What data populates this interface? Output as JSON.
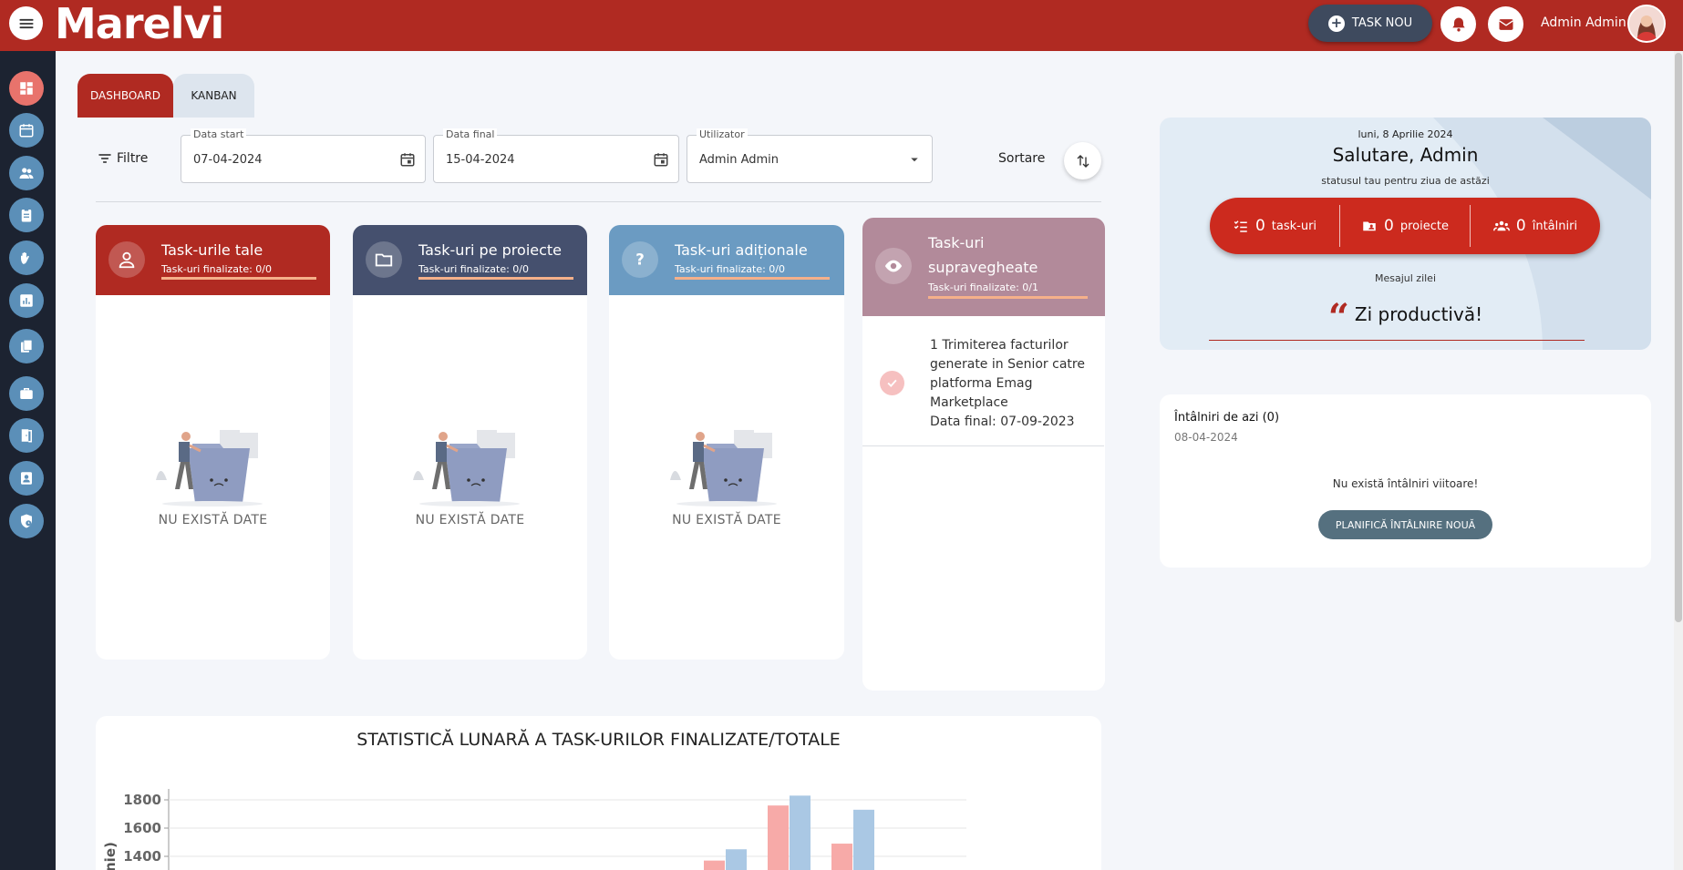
{
  "app": {
    "logo": "Marelvi",
    "new_task_label": "TASK NOU",
    "user_name": "Admin Admin"
  },
  "sidebar": {
    "items": [
      {
        "icon": "dashboard-icon"
      },
      {
        "icon": "calendar-icon"
      },
      {
        "icon": "users-icon"
      },
      {
        "icon": "clipboard-icon"
      },
      {
        "icon": "hand-icon"
      },
      {
        "icon": "bar-chart-icon"
      },
      {
        "icon": "documents-icon"
      },
      {
        "icon": "briefcase-icon"
      },
      {
        "icon": "door-icon"
      },
      {
        "icon": "contact-card-icon"
      },
      {
        "icon": "shield-clock-icon"
      }
    ]
  },
  "tabs": [
    {
      "label": "DASHBOARD",
      "active": true
    },
    {
      "label": "KANBAN",
      "active": false
    }
  ],
  "filters": {
    "label": "Filtre",
    "date_start_label": "Data start",
    "date_start_value": "07-04-2024",
    "date_end_label": "Data final",
    "date_end_value": "15-04-2024",
    "user_label": "Utilizator",
    "user_value": "Admin Admin",
    "sort_label": "Sortare"
  },
  "columns": [
    {
      "title": "Task-urile tale",
      "subtitle": "Task-uri finalizate: 0/0",
      "empty": "NU EXISTĂ DATE",
      "color": "#b02a22"
    },
    {
      "title": "Task-uri pe proiecte",
      "subtitle": "Task-uri finalizate: 0/0",
      "empty": "NU EXISTĂ DATE",
      "color": "#45506e"
    },
    {
      "title": "Task-uri adiționale",
      "subtitle": "Task-uri finalizate: 0/0",
      "empty": "NU EXISTĂ DATE",
      "color": "#6b9bc2"
    },
    {
      "title": "Task-uri supravegheate",
      "title_line1": "Task-uri",
      "title_line2": "supravegheate",
      "subtitle": "Task-uri finalizate: 0/1",
      "color": "#b28a9a",
      "items": [
        {
          "text": "1 Trimiterea facturilor generate in Senior catre platforma Emag Marketplace",
          "deadline": "Data final: 07-09-2023"
        }
      ]
    }
  ],
  "stats": {
    "title": "STATISTICĂ LUNARĂ A TASK-URILOR FINALIZATE/TOTALE",
    "ylabel_visible": "panie)"
  },
  "chart_data": {
    "type": "bar",
    "title": "STATISTICĂ LUNARĂ A TASK-URILOR FINALIZATE/TOTALE",
    "ylabel": "panie)",
    "y_ticks": [
      1400,
      1600,
      1800
    ],
    "ylim": [
      1400,
      1860
    ],
    "grid": true,
    "series": [
      {
        "values": [
          1370,
          1760,
          1490
        ],
        "color": "#f7aaa8"
      },
      {
        "values": [
          1450,
          1830,
          1730
        ],
        "color": "#aac8e4"
      }
    ]
  },
  "greeting": {
    "date": "luni, 8 Aprilie 2024",
    "hello": "Salutare, Admin",
    "status": "statusul tau pentru ziua de astăzi",
    "tasks_count": "0",
    "tasks_label": "task-uri",
    "projects_count": "0",
    "projects_label": "proiecte",
    "meetings_count": "0",
    "meetings_label": "întâlniri",
    "message_label": "Mesajul zilei",
    "quote": "Zi productivă!"
  },
  "meetings": {
    "title": "Întâlniri de azi (0)",
    "date": "08-04-2024",
    "none": "Nu există întâlniri viitoare!",
    "button": "PLANIFICĂ ÎNTÂLNIRE NOUĂ"
  },
  "colors": {
    "brand": "#b02a22",
    "sidebar_bg": "#1c2331",
    "sidebar_icon": "#5b8fb8",
    "sidebar_active": "#e8736c"
  }
}
